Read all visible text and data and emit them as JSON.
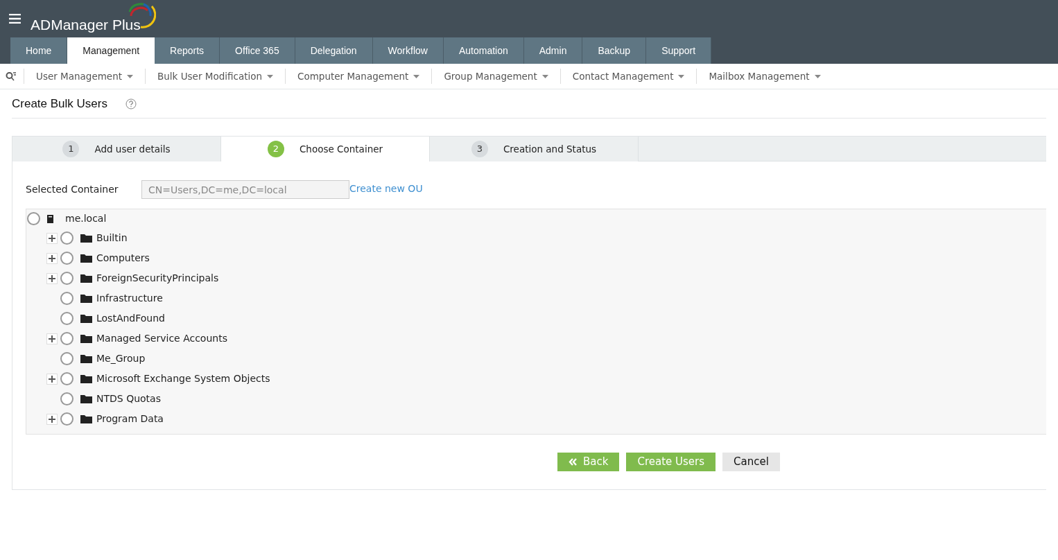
{
  "app": {
    "title": "ADManager Plus"
  },
  "tabs": [
    {
      "label": "Home",
      "selected": false
    },
    {
      "label": "Management",
      "selected": true
    },
    {
      "label": "Reports",
      "selected": false
    },
    {
      "label": "Office 365",
      "selected": false
    },
    {
      "label": "Delegation",
      "selected": false
    },
    {
      "label": "Workflow",
      "selected": false
    },
    {
      "label": "Automation",
      "selected": false
    },
    {
      "label": "Admin",
      "selected": false
    },
    {
      "label": "Backup",
      "selected": false
    },
    {
      "label": "Support",
      "selected": false
    }
  ],
  "submenu": [
    "User Management",
    "Bulk User Modification",
    "Computer Management",
    "Group Management",
    "Contact Management",
    "Mailbox Management"
  ],
  "page_title": "Create Bulk Users",
  "steps": [
    {
      "number": "1",
      "label": "Add user details",
      "selected": false
    },
    {
      "number": "2",
      "label": "Choose Container",
      "selected": true
    },
    {
      "number": "3",
      "label": "Creation and Status",
      "selected": false
    }
  ],
  "selected_container": {
    "label": "Selected Container",
    "value": "CN=Users,DC=me,DC=local",
    "link": "Create new OU"
  },
  "tree": {
    "label": "me.local",
    "selected": false,
    "children": [
      {
        "label": "Builtin",
        "expandable": true,
        "selected": false
      },
      {
        "label": "Computers",
        "expandable": true,
        "selected": false
      },
      {
        "label": "ForeignSecurityPrincipals",
        "expandable": true,
        "selected": false
      },
      {
        "label": "Infrastructure",
        "expandable": false,
        "selected": false
      },
      {
        "label": "LostAndFound",
        "expandable": false,
        "selected": false
      },
      {
        "label": "Managed Service Accounts",
        "expandable": true,
        "selected": false
      },
      {
        "label": "Me_Group",
        "expandable": false,
        "selected": false
      },
      {
        "label": "Microsoft Exchange System Objects",
        "expandable": true,
        "selected": false
      },
      {
        "label": "NTDS Quotas",
        "expandable": false,
        "selected": false
      },
      {
        "label": "Program Data",
        "expandable": true,
        "selected": false
      }
    ]
  },
  "buttons": [
    {
      "label": "Back",
      "kind": "back"
    },
    {
      "label": "Create Users",
      "kind": "primary"
    },
    {
      "label": "Cancel",
      "kind": "secondary"
    }
  ]
}
